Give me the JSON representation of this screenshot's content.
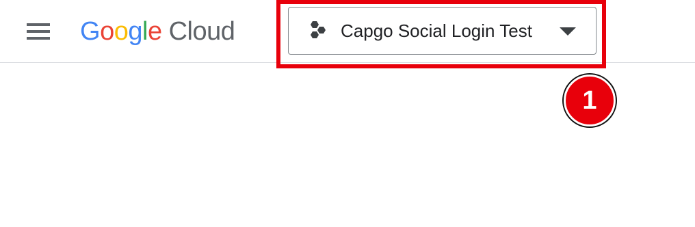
{
  "header": {
    "menu_icon": "hamburger-menu-icon",
    "logo": {
      "letters": [
        {
          "char": "G",
          "color": "#4285F4"
        },
        {
          "char": "o",
          "color": "#EA4335"
        },
        {
          "char": "o",
          "color": "#FBBC05"
        },
        {
          "char": "g",
          "color": "#4285F4"
        },
        {
          "char": "l",
          "color": "#34A853"
        },
        {
          "char": "e",
          "color": "#EA4335"
        }
      ],
      "product": "Cloud",
      "product_color": "#5f6368"
    },
    "project_picker": {
      "icon": "project-hexagons-icon",
      "label": "Capgo Social Login Test",
      "caret_icon": "dropdown-caret-icon"
    }
  },
  "annotation": {
    "highlight_color": "#e8000b",
    "step_number": "1"
  }
}
